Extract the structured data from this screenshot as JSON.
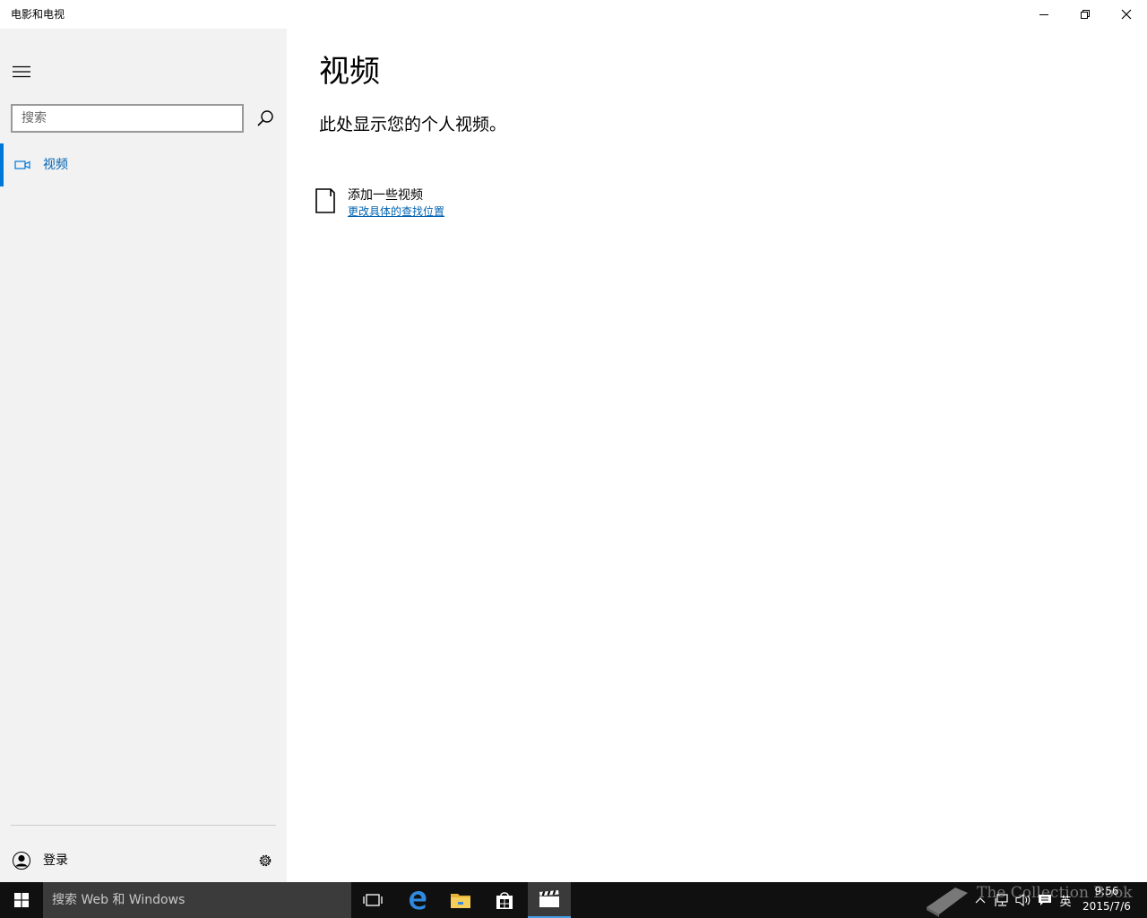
{
  "window": {
    "title": "电影和电视",
    "controls": {
      "minimize": "minimize-icon",
      "restore": "restore-icon",
      "close": "close-icon"
    }
  },
  "sidebar": {
    "search_placeholder": "搜索",
    "nav_items": [
      {
        "label": "视频",
        "icon": "video-camera-icon",
        "selected": true
      }
    ],
    "signin_label": "登录"
  },
  "main": {
    "title": "视频",
    "subtitle": "此处显示您的个人视频。",
    "add_videos_label": "添加一些视频",
    "change_location_link": "更改具体的查找位置"
  },
  "taskbar": {
    "search_placeholder": "搜索 Web 和 Windows",
    "apps": [
      "task-view-icon",
      "edge-icon",
      "file-explorer-icon",
      "store-icon",
      "movies-tv-icon"
    ],
    "language": "英",
    "time": "9:56",
    "date": "2015/7/6",
    "watermark": "The Collection Book"
  },
  "colors": {
    "accent": "#0078d7",
    "link": "#0063b1",
    "sidebar_bg": "#f2f2f2",
    "taskbar_bg": "#101010"
  }
}
